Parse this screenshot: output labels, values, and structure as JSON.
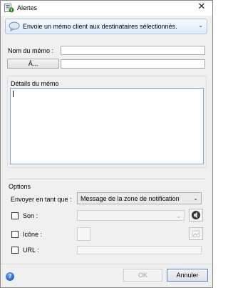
{
  "window": {
    "title": "Alertes"
  },
  "action": {
    "label": "Envoie un mémo client aux destinataires sélectionnés."
  },
  "form": {
    "memo_name_label": "Nom du mémo :",
    "to_button_label": "À...",
    "details_label": "Détails du mémo"
  },
  "options": {
    "group_label": "Options",
    "send_as_label": "Envoyer en tant que :",
    "send_as_value": "Message de la zone de notification",
    "sound_label": "Son :",
    "icon_label": "Icône :",
    "url_label": "URL :"
  },
  "footer": {
    "ok_label": "OK",
    "cancel_label": "Annuler",
    "help_glyph": "?"
  }
}
